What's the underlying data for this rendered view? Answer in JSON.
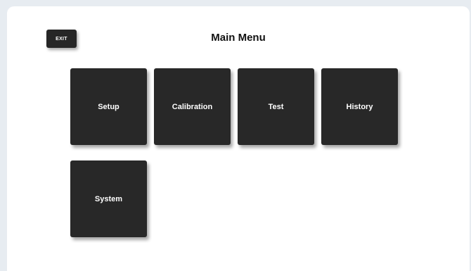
{
  "header": {
    "exit_label": "EXIT",
    "title": "Main Menu"
  },
  "menu": {
    "tiles": [
      {
        "label": "Setup"
      },
      {
        "label": "Calibration"
      },
      {
        "label": "Test"
      },
      {
        "label": "History"
      },
      {
        "label": "System"
      }
    ]
  },
  "colors": {
    "background": "#e7ecf1",
    "panel": "#ffffff",
    "tile": "#282828",
    "tile_text": "#ffffff"
  }
}
